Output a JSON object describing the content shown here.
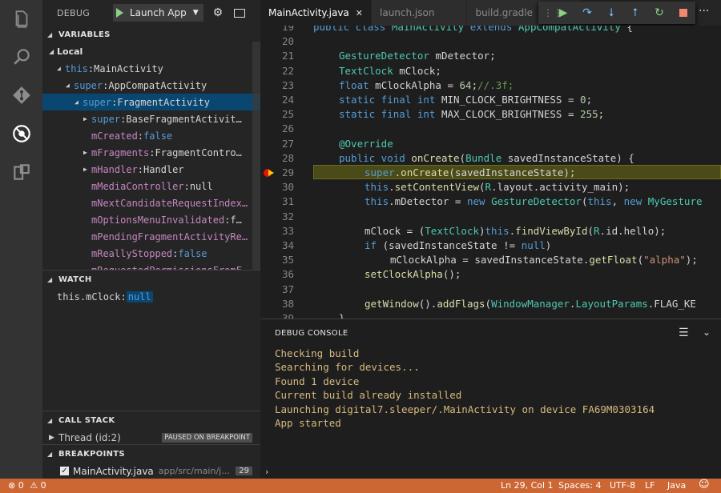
{
  "debug_toolbar": {
    "title": "DEBUG",
    "launch_config": "Launch App"
  },
  "variables": {
    "header": "VARIABLES",
    "scope": "Local",
    "rows": [
      {
        "name": "this",
        "value": "MainActivity",
        "expand": "open",
        "indent": 0
      },
      {
        "name": "super",
        "value": "AppCompatActivity",
        "expand": "open",
        "indent": 1
      },
      {
        "name": "super",
        "value": "FragmentActivity",
        "expand": "open",
        "indent": 2,
        "selected": true
      },
      {
        "name": "super",
        "value": "BaseFragmentActivit…",
        "expand": "closed",
        "indent": 3
      },
      {
        "name": "mCreated",
        "value": "false",
        "expand": "none",
        "indent": 3,
        "literal": true
      },
      {
        "name": "mFragments",
        "value": "FragmentContro…",
        "expand": "closed",
        "indent": 3
      },
      {
        "name": "mHandler",
        "value": "Handler",
        "expand": "closed",
        "indent": 3
      },
      {
        "name": "mMediaController",
        "value": "null",
        "expand": "none",
        "indent": 3
      },
      {
        "name": "mNextCandidateRequestIndex…",
        "value": "",
        "expand": "none",
        "indent": 3
      },
      {
        "name": "mOptionsMenuInvalidated",
        "value": "f…",
        "expand": "none",
        "indent": 3
      },
      {
        "name": "mPendingFragmentActivityRe…",
        "value": "",
        "expand": "none",
        "indent": 3
      },
      {
        "name": "mReallyStopped",
        "value": "false",
        "expand": "none",
        "indent": 3,
        "literal": true
      },
      {
        "name": "mRequestedPermissionsFromF…",
        "value": "",
        "expand": "none",
        "indent": 3
      }
    ]
  },
  "watch": {
    "header": "WATCH",
    "expression": "this.mClock",
    "value": "null"
  },
  "call_stack": {
    "header": "CALL STACK",
    "thread": "Thread (id:2)",
    "status": "PAUSED ON BREAKPOINT"
  },
  "breakpoints": {
    "header": "BREAKPOINTS",
    "file": "MainActivity.java",
    "path": "app/src/main/j…",
    "line": "29"
  },
  "tabs": [
    {
      "label": "MainActivity.java",
      "active": true
    },
    {
      "label": "launch.json",
      "active": false
    },
    {
      "label": "build.gradle",
      "active": false
    }
  ],
  "editor": {
    "lines": [
      {
        "n": "19",
        "html": "<span class='kw'>public class</span> <span class='ty'>MainActivity</span> <span class='kw'>extends</span> <span class='ty'>AppCompatActivity</span> {",
        "indent": 0
      },
      {
        "n": "20",
        "html": "",
        "indent": 0
      },
      {
        "n": "21",
        "html": "<span class='ty'>GestureDetector</span> mDetector;",
        "indent": 1
      },
      {
        "n": "22",
        "html": "<span class='ty'>TextClock</span> mClock;",
        "indent": 1
      },
      {
        "n": "23",
        "html": "<span class='kw'>float</span> mClockAlpha = <span class='num'>64</span>;<span class='cm'>//.3f;</span>",
        "indent": 1
      },
      {
        "n": "24",
        "html": "<span class='kw'>static final int</span> MIN_CLOCK_BRIGHTNESS = <span class='num'>0</span>;",
        "indent": 1
      },
      {
        "n": "25",
        "html": "<span class='kw'>static final int</span> MAX_CLOCK_BRIGHTNESS = <span class='num'>255</span>;",
        "indent": 1
      },
      {
        "n": "26",
        "html": "",
        "indent": 0
      },
      {
        "n": "27",
        "html": "<span class='ty'>@Override</span>",
        "indent": 1
      },
      {
        "n": "28",
        "html": "<span class='kw'>public void</span> <span class='fn'>onCreate</span>(<span class='ty'>Bundle</span> savedInstanceState) {",
        "indent": 1
      },
      {
        "n": "29",
        "html": "<span class='kw'>super</span>.<span class='fn'>onCreate</span>(savedInstanceState);",
        "indent": 2
      },
      {
        "n": "30",
        "html": "<span class='kw'>this</span>.<span class='fn'>setContentView</span>(<span class='ty'>R</span>.layout.activity_main);",
        "indent": 2
      },
      {
        "n": "31",
        "html": "<span class='kw'>this</span>.mDetector = <span class='kw'>new</span> <span class='ty'>GestureDetector</span>(<span class='kw'>this</span>, <span class='kw'>new</span> <span class='ty'>MyGesture</span>",
        "indent": 2
      },
      {
        "n": "32",
        "html": "",
        "indent": 0
      },
      {
        "n": "33",
        "html": "mClock = (<span class='ty'>TextClock</span>)<span class='kw'>this</span>.<span class='fn'>findViewById</span>(<span class='ty'>R</span>.id.hello);",
        "indent": 2
      },
      {
        "n": "34",
        "html": "<span class='kw'>if</span> (savedInstanceState != <span class='kw'>null</span>)",
        "indent": 2
      },
      {
        "n": "35",
        "html": "mClockAlpha = savedInstanceState.<span class='fn'>getFloat</span>(<span class='str'>\"alpha\"</span>);",
        "indent": 3
      },
      {
        "n": "36",
        "html": "<span class='fn'>setClockAlpha</span>();",
        "indent": 2
      },
      {
        "n": "37",
        "html": "",
        "indent": 0
      },
      {
        "n": "38",
        "html": "<span class='fn'>getWindow</span>().<span class='fn'>addFlags</span>(<span class='ty'>WindowManager</span>.<span class='ty'>LayoutParams</span>.FLAG_KE",
        "indent": 2
      },
      {
        "n": "39",
        "html": "}",
        "indent": 1
      }
    ]
  },
  "console": {
    "title": "DEBUG CONSOLE",
    "lines": [
      "Checking build",
      "Searching for devices...",
      "Found 1 device",
      "Current build already installed",
      "Launching digital7.sleeper/.MainActivity on device FA69M0303164",
      "App started"
    ],
    "prompt": "›"
  },
  "status": {
    "errors": "0",
    "warnings": "0",
    "position": "Ln 29, Col 1",
    "spaces": "Spaces: 4",
    "encoding": "UTF-8",
    "eol": "LF",
    "language": "Java"
  },
  "colors": {
    "statusbar": "#cc6633",
    "selection": "#094771",
    "console_text": "#d7ba7d",
    "breakpoint": "#e51400"
  }
}
